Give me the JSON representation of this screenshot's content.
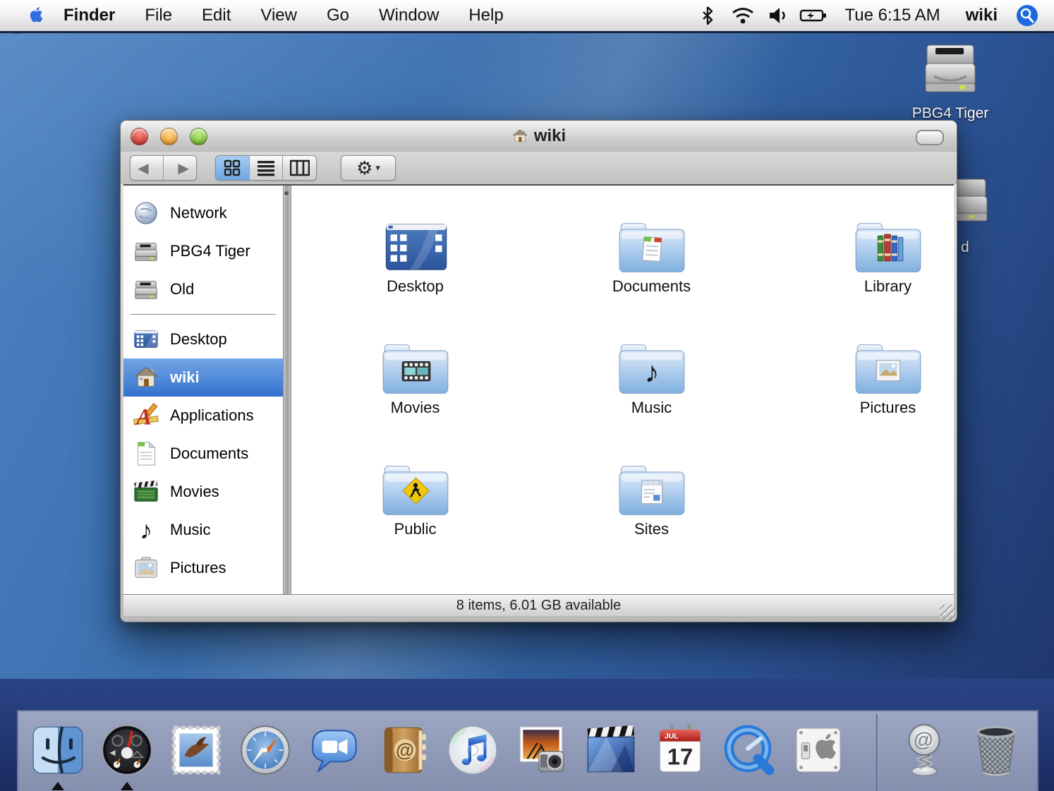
{
  "menu_bar": {
    "items": [
      "Finder",
      "File",
      "Edit",
      "View",
      "Go",
      "Window",
      "Help"
    ],
    "status_icons": [
      "bluetooth-icon",
      "wifi-icon",
      "volume-icon",
      "battery-icon"
    ],
    "time": "Tue 6:15 AM",
    "user": "wiki",
    "spotlight_color": "#1f68e0"
  },
  "desktop": {
    "volumes": [
      {
        "label": "PBG4 Tiger",
        "icon": "harddisk"
      },
      {
        "label": "d",
        "icon": "harddisk-partial"
      }
    ]
  },
  "window": {
    "title": "wiki",
    "title_icon": "home-icon",
    "toolbar": {
      "back_label": "◀",
      "forward_label": "▶",
      "view_modes": [
        "icon-view",
        "list-view",
        "column-view"
      ],
      "selected_view": "icon-view",
      "action_gear": "⚙",
      "action_caret": "▾",
      "search_value": "",
      "search_placeholder": ""
    },
    "sidebar": [
      {
        "label": "Network",
        "icon": "network",
        "selected": false
      },
      {
        "label": "PBG4 Tiger",
        "icon": "harddisk",
        "selected": false
      },
      {
        "label": "Old",
        "icon": "harddisk",
        "selected": false,
        "separator_after": true
      },
      {
        "label": "Desktop",
        "icon": "desktop-mini",
        "selected": false
      },
      {
        "label": "wiki",
        "icon": "home",
        "selected": true
      },
      {
        "label": "Applications",
        "icon": "applications",
        "selected": false
      },
      {
        "label": "Documents",
        "icon": "document",
        "selected": false
      },
      {
        "label": "Movies",
        "icon": "movies-side",
        "selected": false
      },
      {
        "label": "Music",
        "icon": "music-side",
        "selected": false
      },
      {
        "label": "Pictures",
        "icon": "pictures-side",
        "selected": false
      }
    ],
    "folders": [
      {
        "label": "Desktop",
        "icon": "desktop-big"
      },
      {
        "label": "Documents",
        "icon": "folder-documents"
      },
      {
        "label": "Library",
        "icon": "folder-library"
      },
      {
        "label": "Movies",
        "icon": "folder-movies"
      },
      {
        "label": "Music",
        "icon": "folder-music"
      },
      {
        "label": "Pictures",
        "icon": "folder-pictures"
      },
      {
        "label": "Public",
        "icon": "folder-public"
      },
      {
        "label": "Sites",
        "icon": "folder-sites"
      }
    ],
    "status_bar": "8 items, 6.01 GB available",
    "selection_color": "#3272cf"
  },
  "dock": {
    "apps": [
      {
        "name": "finder",
        "running": true
      },
      {
        "name": "dashboard",
        "running": true
      },
      {
        "name": "mail",
        "running": false
      },
      {
        "name": "safari",
        "running": false
      },
      {
        "name": "ichat",
        "running": false
      },
      {
        "name": "address-book",
        "running": false
      },
      {
        "name": "itunes",
        "running": false
      },
      {
        "name": "iphoto",
        "running": false
      },
      {
        "name": "imovie",
        "running": false
      },
      {
        "name": "ical",
        "running": false
      },
      {
        "name": "quicktime",
        "running": false
      },
      {
        "name": "system-preferences",
        "running": false
      }
    ],
    "right": [
      {
        "name": "internet-shortcut-stamp"
      },
      {
        "name": "trash"
      }
    ],
    "ical_month": "JUL",
    "ical_day": "17"
  }
}
